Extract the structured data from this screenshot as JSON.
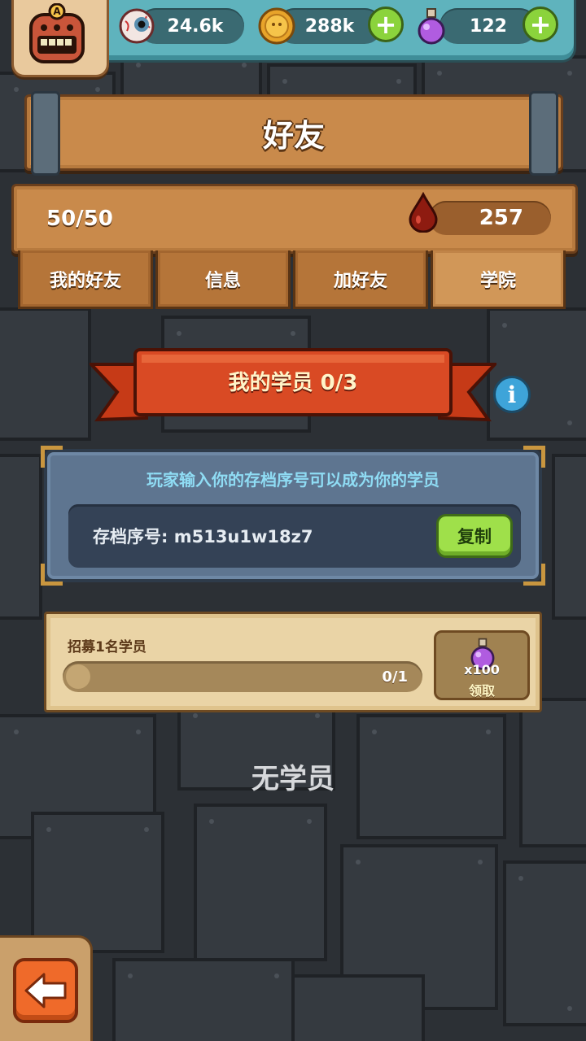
{
  "resources": {
    "eyes": {
      "value": "24.6k",
      "icon": "eyeball-icon"
    },
    "coins": {
      "value": "288k",
      "icon": "coin-icon"
    },
    "potions": {
      "value": "122",
      "icon": "potion-icon"
    }
  },
  "avatar": {
    "letter": "A"
  },
  "title": "好友",
  "friends_count": "50/50",
  "blood": {
    "value": "257",
    "icon": "blood-drop-icon"
  },
  "tabs": [
    {
      "label": "我的好友"
    },
    {
      "label": "信息"
    },
    {
      "label": "加好友"
    },
    {
      "label": "学院"
    }
  ],
  "active_tab": 3,
  "banner": "我的学员 0/3",
  "invite": {
    "hint": "玩家输入你的存档序号可以成为你的学员",
    "code_text": "存档序号: m513u1w18z7",
    "copy_label": "复制"
  },
  "task": {
    "label": "招募1名学员",
    "progress_text": "0/1",
    "progress_fraction": 0,
    "reward_qty": "x100",
    "claim_label": "领取"
  },
  "empty_text": "无学员",
  "colors": {
    "accent_green": "#9fe04a",
    "wood": "#c98a4b",
    "ribbon": "#d94a24"
  }
}
